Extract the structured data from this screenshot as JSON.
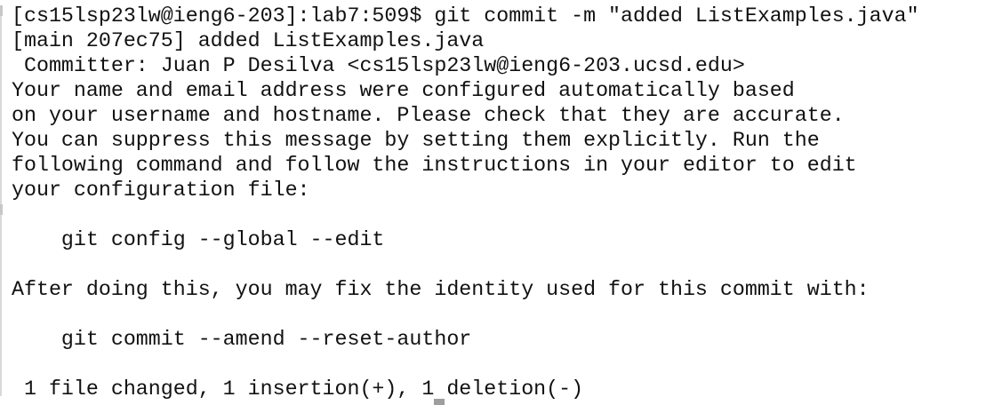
{
  "terminal": {
    "lines": [
      "[cs15lsp23lw@ieng6-203]:lab7:509$ git commit -m \"added ListExamples.java\"",
      "[main 207ec75] added ListExamples.java",
      " Committer: Juan P Desilva <cs15lsp23lw@ieng6-203.ucsd.edu>",
      "Your name and email address were configured automatically based",
      "on your username and hostname. Please check that they are accurate.",
      "You can suppress this message by setting them explicitly. Run the",
      "following command and follow the instructions in your editor to edit",
      "your configuration file:",
      "",
      "    git config --global --edit",
      "",
      "After doing this, you may fix the identity used for this commit with:",
      "",
      "    git commit --amend --reset-author",
      "",
      " 1 file changed, 1 insertion(+), 1 deletion(-)"
    ]
  }
}
